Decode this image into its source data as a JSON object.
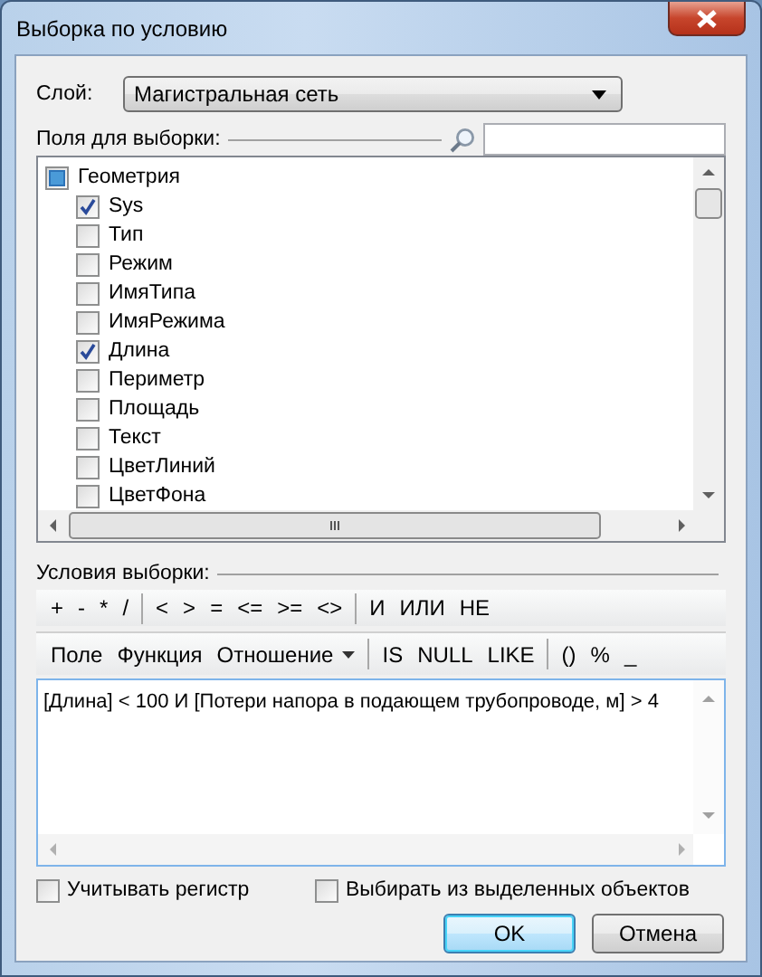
{
  "window": {
    "title": "Выборка по условию"
  },
  "layer": {
    "label": "Слой:",
    "value": "Магистральная сеть"
  },
  "fields": {
    "label": "Поля для выборки:",
    "tree": [
      {
        "label": "Геометрия",
        "indeterminate": true,
        "children": [
          {
            "label": "Sys",
            "checked": true
          },
          {
            "label": "Тип",
            "checked": false
          },
          {
            "label": "Режим",
            "checked": false
          },
          {
            "label": "ИмяТипа",
            "checked": false
          },
          {
            "label": "ИмяРежима",
            "checked": false
          },
          {
            "label": "Длина",
            "checked": true
          },
          {
            "label": "Периметр",
            "checked": false
          },
          {
            "label": "Площадь",
            "checked": false
          },
          {
            "label": "Текст",
            "checked": false
          },
          {
            "label": "ЦветЛиний",
            "checked": false
          },
          {
            "label": "ЦветФона",
            "checked": false
          }
        ]
      }
    ]
  },
  "conditions": {
    "label": "Условия выборки:",
    "toolbars": [
      [
        [
          {
            "label": "+"
          },
          {
            "label": "-"
          },
          {
            "label": "*"
          },
          {
            "label": "/"
          }
        ],
        [
          {
            "label": "<"
          },
          {
            "label": ">"
          },
          {
            "label": "="
          },
          {
            "label": "<="
          },
          {
            "label": ">="
          },
          {
            "label": "<>"
          }
        ],
        [
          {
            "label": "И"
          },
          {
            "label": "ИЛИ"
          },
          {
            "label": "НЕ"
          }
        ]
      ],
      [
        [
          {
            "label": "Поле"
          },
          {
            "label": "Функция"
          },
          {
            "label": "Отношение",
            "has_menu": true
          }
        ],
        [
          {
            "label": "IS"
          },
          {
            "label": "NULL"
          },
          {
            "label": "LIKE"
          }
        ],
        [
          {
            "label": "()"
          },
          {
            "label": "%"
          },
          {
            "label": "_"
          }
        ]
      ]
    ],
    "expression": "[Длина] < 100 И [Потери напора в подающем трубопроводе, м] > 4"
  },
  "options": [
    {
      "label": "Учитывать регистр",
      "checked": false
    },
    {
      "label": "Выбирать из выделенных объектов",
      "checked": false
    }
  ],
  "buttons": [
    {
      "label": "OK",
      "default": true
    },
    {
      "label": "Отмена",
      "default": false
    }
  ]
}
